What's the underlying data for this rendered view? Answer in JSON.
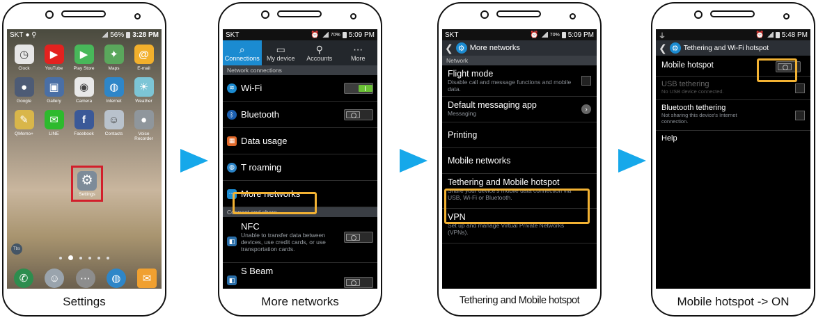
{
  "colors": {
    "arrow": "#16a8ea",
    "highlight": "#f2b233",
    "settings_box": "#d21f2b",
    "active_tab": "#1b8bd1"
  },
  "phone1": {
    "caption": "Settings",
    "status": {
      "left": "SKT",
      "battery": "56%",
      "time": "3:28 PM"
    },
    "apps": [
      {
        "label": "Clock",
        "icon": "clock-icon",
        "color": "#e6e6e6",
        "glyph": "◷"
      },
      {
        "label": "YouTube",
        "icon": "youtube-icon",
        "color": "#e3221f",
        "glyph": "▶"
      },
      {
        "label": "Play Store",
        "icon": "play-store-icon",
        "color": "#48b85a",
        "glyph": "▶"
      },
      {
        "label": "Maps",
        "icon": "maps-icon",
        "color": "#5aa75c",
        "glyph": "✦"
      },
      {
        "label": "E-mail",
        "icon": "email-icon",
        "color": "#f2b02c",
        "glyph": "@"
      },
      {
        "label": "Google",
        "icon": "google-folder-icon",
        "color": "#4d5b75",
        "glyph": "●"
      },
      {
        "label": "Gallery",
        "icon": "gallery-icon",
        "color": "#4a6fa5",
        "glyph": "▣"
      },
      {
        "label": "Camera",
        "icon": "camera-icon",
        "color": "#e8e8e8",
        "glyph": "◉"
      },
      {
        "label": "Internet",
        "icon": "internet-icon",
        "color": "#2e86c8",
        "glyph": "◍"
      },
      {
        "label": "Weather",
        "icon": "weather-icon",
        "color": "#7cc5d6",
        "glyph": "☀"
      },
      {
        "label": "QMemo+",
        "icon": "qmemo-icon",
        "color": "#d9b64a",
        "glyph": "✎"
      },
      {
        "label": "LINE",
        "icon": "line-icon",
        "color": "#2dba2d",
        "glyph": "✉"
      },
      {
        "label": "Facebook",
        "icon": "facebook-icon",
        "color": "#3b5998",
        "glyph": "f"
      },
      {
        "label": "Contacts",
        "icon": "contacts-icon",
        "color": "#b9c2cc",
        "glyph": "☺"
      },
      {
        "label": "Voice Recorder",
        "icon": "voice-recorder-icon",
        "color": "#8f969c",
        "glyph": "●"
      }
    ],
    "settings_label": "Settings",
    "badge": "Tbs",
    "dock": [
      {
        "icon": "phone-icon",
        "color": "#2d8d4e",
        "glyph": "✆"
      },
      {
        "icon": "contacts-dock-icon",
        "color": "#9aa4ad",
        "glyph": "☺"
      },
      {
        "icon": "apps-icon",
        "color": "#8d8d8d",
        "glyph": "⋯"
      },
      {
        "icon": "browser-icon",
        "color": "#2e86c8",
        "glyph": "◍"
      },
      {
        "icon": "email-dock-icon",
        "color": "#f0a030",
        "glyph": "✉"
      }
    ]
  },
  "phone2": {
    "caption": "More networks",
    "status": {
      "left": "SKT",
      "battery": "70%",
      "time": "5:09 PM"
    },
    "tabs": [
      {
        "label": "Connections",
        "glyph": "⌕",
        "icon": "connections-icon"
      },
      {
        "label": "My device",
        "glyph": "▭",
        "icon": "my-device-icon"
      },
      {
        "label": "Accounts",
        "glyph": "⚲",
        "icon": "accounts-icon"
      },
      {
        "label": "More",
        "glyph": "⋯",
        "icon": "more-icon"
      }
    ],
    "section_network": "Network connections",
    "wifi": "Wi-Fi",
    "bluetooth": "Bluetooth",
    "data_usage": "Data usage",
    "t_roaming": "T roaming",
    "more_networks": "More networks",
    "section_share": "Connect and share",
    "nfc_title": "NFC",
    "nfc_sub": "Unable to transfer data between devices, use credit cards, or use transportation cards.",
    "sbeam": "S Beam"
  },
  "phone3": {
    "caption": "Tethering and Mobile hotspot",
    "status": {
      "left": "SKT",
      "battery": "70%",
      "time": "5:09 PM"
    },
    "header": "More networks",
    "section": "Network",
    "items": [
      {
        "title": "Flight mode",
        "sub": "Disable call and message functions and mobile data.",
        "control": "check"
      },
      {
        "title": "Default messaging app",
        "sub": "Messaging",
        "control": "chev"
      },
      {
        "title": "Printing",
        "sub": "",
        "control": ""
      },
      {
        "title": "Mobile networks",
        "sub": "",
        "control": ""
      },
      {
        "title": "Tethering and Mobile hotspot",
        "sub": "Share your device's mobile data connection via USB, Wi-Fi or Bluetooth.",
        "control": ""
      },
      {
        "title": "VPN",
        "sub": "Set up and manage Virtual Private Networks (VPNs).",
        "control": ""
      }
    ]
  },
  "phone4": {
    "caption": "Mobile hotspot -> ON",
    "status": {
      "time": "5:48 PM"
    },
    "header": "Tethering and Wi-Fi hotspot",
    "mobile_hotspot": "Mobile hotspot",
    "usb_title": "USB tethering",
    "usb_sub": "No USB device connected.",
    "bt_title": "Bluetooth tethering",
    "bt_sub": "Not sharing this device's Internet connection.",
    "help": "Help"
  }
}
